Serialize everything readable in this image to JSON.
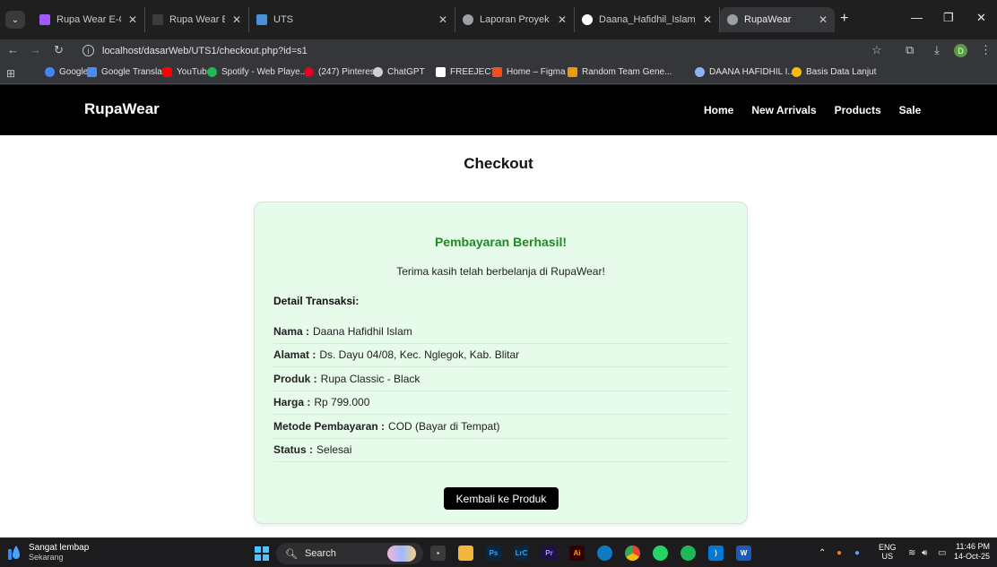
{
  "browser": {
    "tabs": [
      {
        "title": "Rupa Wear E-Commerce -",
        "favicon_color": "#a259ff",
        "active": false
      },
      {
        "title": "Rupa Wear E-Commerce",
        "favicon_color": "#3c3c3c",
        "active": false
      },
      {
        "title": "UTS",
        "favicon_color": "#4a90d9",
        "active": false
      },
      {
        "title": "Laporan Proyek UTS.docx",
        "favicon_color": "#9aa0a6",
        "active": false
      },
      {
        "title": "Daana_Hafidhil_Islam_DES",
        "favicon_color": "#ffffff",
        "active": false
      },
      {
        "title": "RupaWear",
        "favicon_color": "#9aa0a6",
        "active": true
      }
    ],
    "url": "localhost/dasarWeb/UTS1/checkout.php?id=s1",
    "profile_initial": "D",
    "bookmarks": [
      {
        "label": "Google",
        "color": "#4285f4"
      },
      {
        "label": "Google Translate",
        "color": "#4c8bf5"
      },
      {
        "label": "YouTube",
        "color": "#ff0000"
      },
      {
        "label": "Spotify - Web Playe...",
        "color": "#1db954"
      },
      {
        "label": "(247) Pinterest",
        "color": "#e60023"
      },
      {
        "label": "ChatGPT",
        "color": "#d0d0d0"
      },
      {
        "label": "FREEJECT",
        "color": "#ffffff"
      },
      {
        "label": "Home – Figma",
        "color": "#f24e1e"
      },
      {
        "label": "Random Team Gene...",
        "color": "#f29900"
      },
      {
        "label": "DAANA HAFIDHIL I...",
        "color": "#8ab4f8"
      },
      {
        "label": "Basis Data Lanjut",
        "color": "#fbbc04"
      }
    ]
  },
  "site": {
    "brand": "RupaWear",
    "menu": [
      "Home",
      "New Arrivals",
      "Products",
      "Sale"
    ]
  },
  "checkout": {
    "title": "Checkout",
    "success": "Pembayaran Berhasil!",
    "thanks": "Terima kasih telah berbelanja di RupaWear!",
    "detail_heading": "Detail Transaksi:",
    "rows": [
      {
        "label": "Nama :",
        "value": "Daana Hafidhil Islam"
      },
      {
        "label": "Alamat :",
        "value": "Ds. Dayu 04/08, Kec. Nglegok, Kab. Blitar"
      },
      {
        "label": "Produk :",
        "value": "Rupa Classic - Black"
      },
      {
        "label": "Harga :",
        "value": "Rp 799.000"
      },
      {
        "label": "Metode Pembayaran :",
        "value": "COD (Bayar di Tempat)"
      },
      {
        "label": "Status :",
        "value": "Selesai"
      }
    ],
    "back_button": "Kembali ke Produk"
  },
  "taskbar": {
    "weather_line1": "Sangat lembap",
    "weather_line2": "Sekarang",
    "search_label": "Search",
    "lang_line1": "ENG",
    "lang_line2": "US",
    "time": "11:46 PM",
    "date": "14-Oct-25"
  }
}
